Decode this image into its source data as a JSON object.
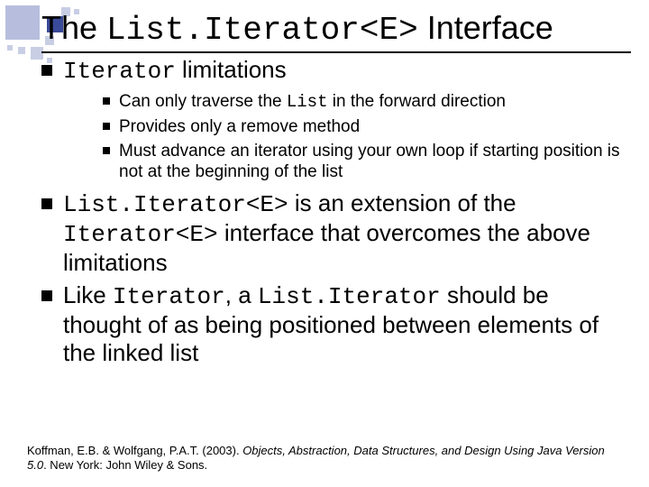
{
  "title": {
    "pre": "The ",
    "code": "List.Iterator<E>",
    "post": " Interface"
  },
  "bullets": [
    {
      "segments": [
        {
          "t": "Iterator",
          "mono": true
        },
        {
          "t": " limitations"
        }
      ],
      "sub": [
        {
          "segments": [
            {
              "t": "Can only traverse the "
            },
            {
              "t": "List",
              "mono": true
            },
            {
              "t": " in the forward direction"
            }
          ]
        },
        {
          "segments": [
            {
              "t": "Provides only a remove method"
            }
          ]
        },
        {
          "segments": [
            {
              "t": "Must advance an iterator using your own loop if starting position is not at the beginning of the list"
            }
          ]
        }
      ]
    },
    {
      "segments": [
        {
          "t": "List.Iterator<E>",
          "mono": true
        },
        {
          "t": " is an extension of the "
        },
        {
          "t": "Iterator<E>",
          "mono": true
        },
        {
          "t": " interface that overcomes the above limitations"
        }
      ]
    },
    {
      "segments": [
        {
          "t": "Like "
        },
        {
          "t": "Iterator",
          "mono": true
        },
        {
          "t": ", a "
        },
        {
          "t": "List.Iterator",
          "mono": true
        },
        {
          "t": " should be thought of as being positioned between elements of the linked list"
        }
      ]
    }
  ],
  "citation": {
    "authors": "Koffman, E.B. & Wolfgang, P.A.T. (2003). ",
    "title_italic": "Objects, Abstraction, Data Structures, and Design Using Java Version 5.0",
    "rest": ". New York: John Wiley & Sons."
  }
}
